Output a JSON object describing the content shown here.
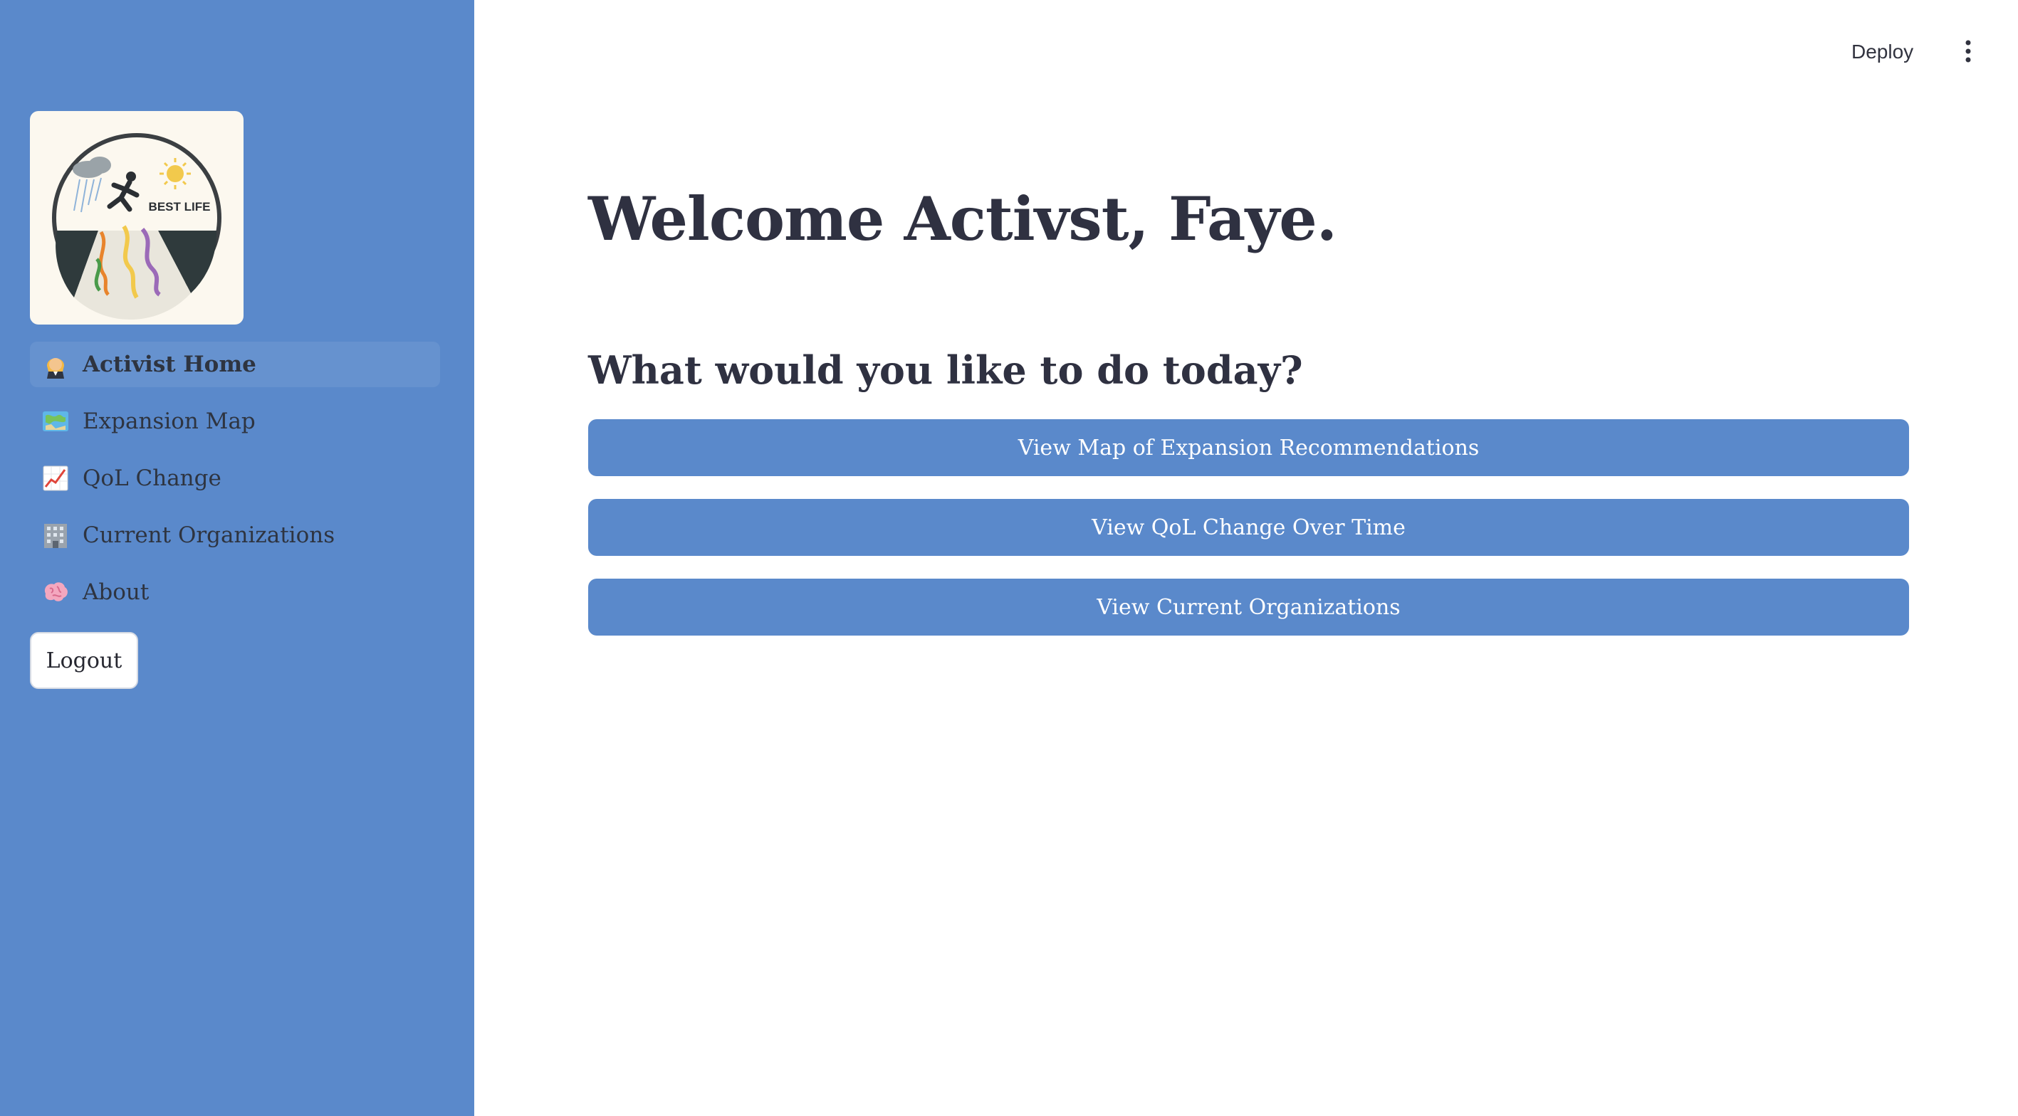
{
  "toolbar": {
    "deploy_label": "Deploy",
    "menu_icon": "vertical-ellipsis-icon"
  },
  "sidebar": {
    "logo": {
      "icon": "best-life-logo",
      "text": "BEST LIFE"
    },
    "nav_items": [
      {
        "label": "Activist Home",
        "icon": "woman-judge-emoji",
        "active": true
      },
      {
        "label": "Expansion Map",
        "icon": "map-emoji",
        "active": false
      },
      {
        "label": "QoL Change",
        "icon": "chart-increasing-emoji",
        "active": false
      },
      {
        "label": "Current Organizations",
        "icon": "office-building-emoji",
        "active": false
      },
      {
        "label": "About",
        "icon": "brain-emoji",
        "active": false
      }
    ],
    "logout_label": "Logout"
  },
  "main": {
    "title": "Welcome Activst, Faye.",
    "subtitle": "What would you like to do today?",
    "buttons": [
      {
        "label": "View Map of Expansion Recommendations"
      },
      {
        "label": "View QoL Change Over Time"
      },
      {
        "label": "View Current Organizations"
      }
    ]
  },
  "colors": {
    "sidebar_bg": "#5a89cb",
    "button_bg": "#5a89cb",
    "text_dark": "#2f3141",
    "logo_bg": "#fcf8ef"
  }
}
